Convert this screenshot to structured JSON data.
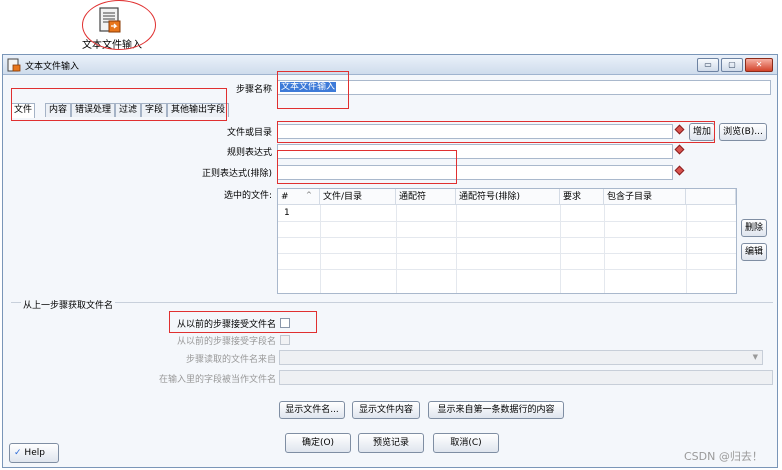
{
  "desktop_icon": {
    "label": "文本文件输入",
    "icon": "text-file-input-icon"
  },
  "window": {
    "title": "文本文件输入",
    "controls": {
      "minimize": "▭",
      "maximize": "▢",
      "close": "✕"
    }
  },
  "step_name": {
    "label": "步骤名称",
    "value": "文本文件输入"
  },
  "tabs": [
    {
      "label": "文件"
    },
    {
      "label": "内容"
    },
    {
      "label": "错误处理"
    },
    {
      "label": "过滤"
    },
    {
      "label": "字段"
    },
    {
      "label": "其他输出字段"
    }
  ],
  "file": {
    "file_or_dir_label": "文件或目录",
    "regex_label": "规则表达式",
    "regex_exclude_label": "正则表达式(排除)",
    "add_button": "增加",
    "browse_button": "浏览(B)...",
    "selected_files_label": "选中的文件:",
    "table_headers": [
      "#",
      "文件/目录",
      "通配符",
      "通配符号(排除)",
      "要求",
      "包含子目录"
    ],
    "table_rows": [
      {
        "index": "1"
      }
    ],
    "delete_button": "删除",
    "edit_button": "编辑"
  },
  "prev_step": {
    "section_title": "从上一步骤获取文件名",
    "accept_filenames_label": "从以前的步骤接受文件名",
    "accept_fields_label": "从以前的步骤接受字段名",
    "read_from_step_label": "步骤读取的文件名来自",
    "field_as_filename_label": "在输入里的字段被当作文件名"
  },
  "actions": {
    "show_filenames": "显示文件名...",
    "show_file_content": "显示文件内容",
    "show_first_row": "显示来自第一条数据行的内容"
  },
  "footer": {
    "help": "Help",
    "ok": "确定(O)",
    "preview": "预览记录",
    "cancel": "取消(C)"
  },
  "watermark": "CSDN @归去！",
  "colors": {
    "highlight": "#e03030",
    "accent": "#3d7ad8"
  }
}
